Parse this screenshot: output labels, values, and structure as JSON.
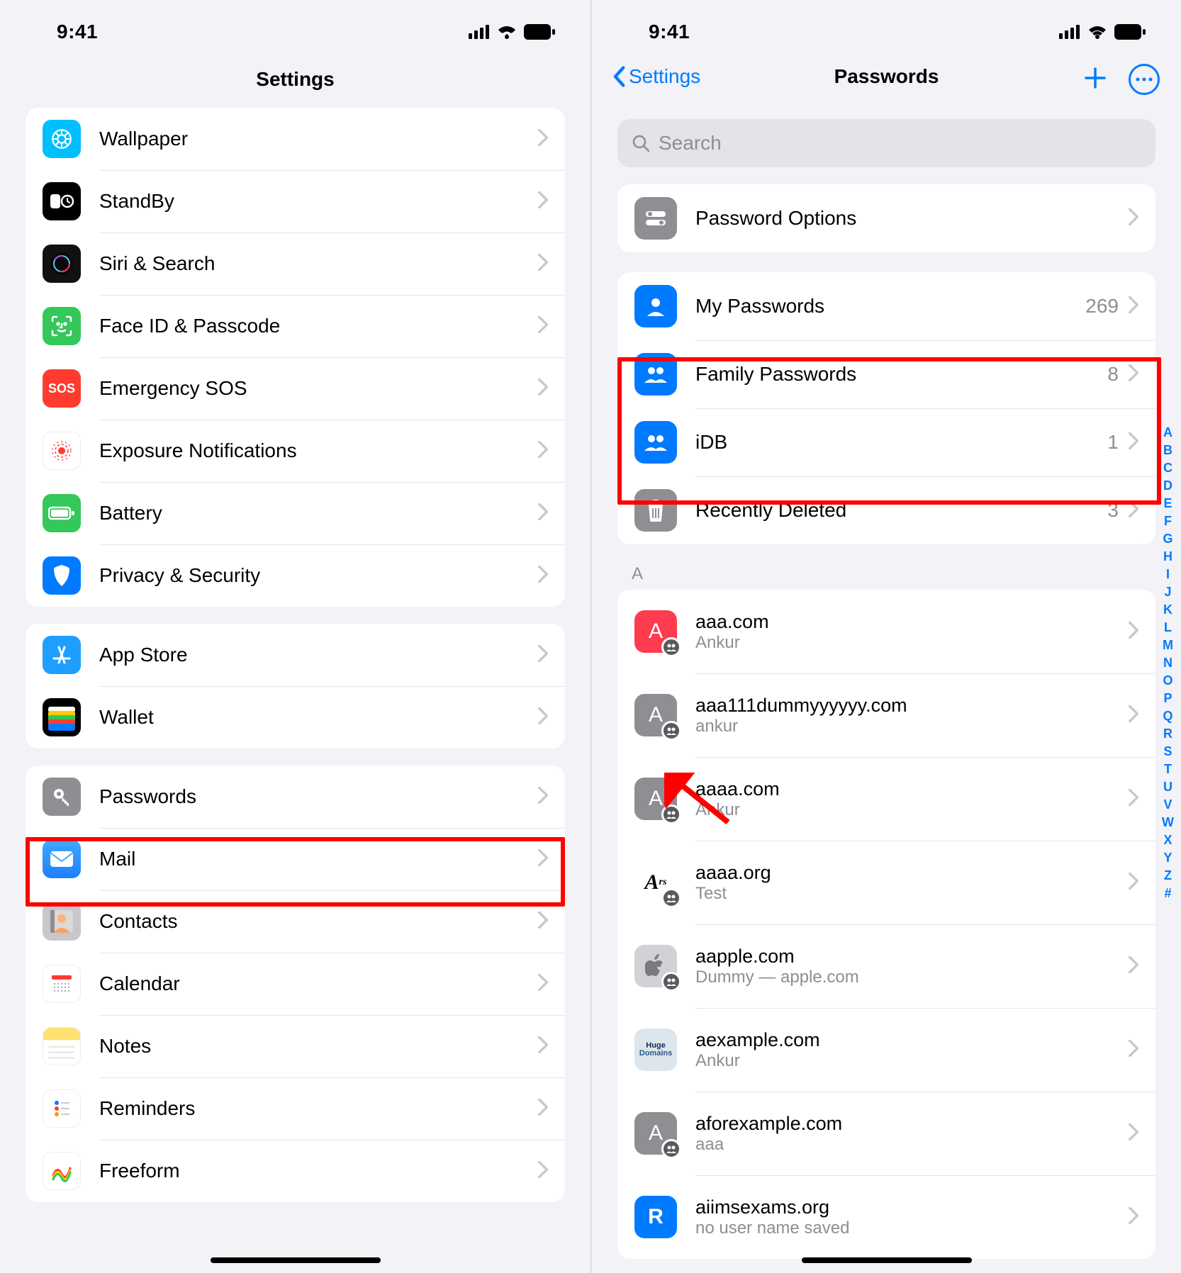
{
  "status": {
    "time": "9:41"
  },
  "left": {
    "title": "Settings",
    "group1": [
      {
        "label": "Wallpaper",
        "icon": "wallpaper",
        "bg": "#00BFFF"
      },
      {
        "label": "StandBy",
        "icon": "standby",
        "bg": "#000000"
      },
      {
        "label": "Siri & Search",
        "icon": "siri",
        "bg": "#222"
      },
      {
        "label": "Face ID & Passcode",
        "icon": "faceid",
        "bg": "#34C759"
      },
      {
        "label": "Emergency SOS",
        "icon": "sos",
        "bg": "#FF3B30",
        "text": "SOS"
      },
      {
        "label": "Exposure Notifications",
        "icon": "exposure",
        "bg": "#FFFFFF"
      },
      {
        "label": "Battery",
        "icon": "battery",
        "bg": "#34C759"
      },
      {
        "label": "Privacy & Security",
        "icon": "privacy",
        "bg": "#007AFF"
      }
    ],
    "group2": [
      {
        "label": "App Store",
        "icon": "appstore",
        "bg": "#1E9FFF"
      },
      {
        "label": "Wallet",
        "icon": "wallet",
        "bg": "#FFFFFF"
      }
    ],
    "group3": [
      {
        "label": "Passwords",
        "icon": "passwords",
        "bg": "#8E8E93"
      },
      {
        "label": "Mail",
        "icon": "mail",
        "bg": "#1E90FF"
      },
      {
        "label": "Contacts",
        "icon": "contacts",
        "bg": "#B8B8BE"
      },
      {
        "label": "Calendar",
        "icon": "calendar",
        "bg": "#FFFFFF"
      },
      {
        "label": "Notes",
        "icon": "notes",
        "bg": "#FFE070"
      },
      {
        "label": "Reminders",
        "icon": "reminders",
        "bg": "#FFFFFF"
      },
      {
        "label": "Freeform",
        "icon": "freeform",
        "bg": "#FFFFFF"
      }
    ]
  },
  "right": {
    "back": "Settings",
    "title": "Passwords",
    "searchPlaceholder": "Search",
    "options": {
      "label": "Password Options"
    },
    "groups": [
      {
        "label": "My Passwords",
        "count": "269",
        "icon": "person",
        "bg": "#007AFF"
      },
      {
        "label": "Family Passwords",
        "count": "8",
        "icon": "people",
        "bg": "#007AFF"
      },
      {
        "label": "iDB",
        "count": "1",
        "icon": "people",
        "bg": "#007AFF"
      },
      {
        "label": "Recently Deleted",
        "count": "3",
        "icon": "trash",
        "bg": "#8E8E93"
      }
    ],
    "sectionHeader": "A",
    "entries": [
      {
        "title": "aaa.com",
        "sub": "Ankur",
        "tileBg": "#FF3B4E",
        "letter": "A",
        "shared": true
      },
      {
        "title": "aaa111dummyyyyyy.com",
        "sub": "ankur",
        "tileBg": "#8E8E93",
        "letter": "A",
        "shared": true
      },
      {
        "title": "aaaa.com",
        "sub": "Ankur",
        "tileBg": "#8E8E93",
        "letter": "A",
        "shared": true
      },
      {
        "title": "aaaa.org",
        "sub": "Test",
        "tileBg": "#FFFFFF",
        "black": true,
        "letter": "A₂",
        "shared": true
      },
      {
        "title": "aapple.com",
        "sub": "Dummy — apple.com",
        "tileBg": "#C7C7CC",
        "apple": true,
        "shared": true
      },
      {
        "title": "aexample.com",
        "sub": "Ankur",
        "tileBg": "#DDE6EC",
        "huge": true,
        "shared": false
      },
      {
        "title": "aforexample.com",
        "sub": "aaa",
        "tileBg": "#8E8E93",
        "letter": "A",
        "shared": true
      },
      {
        "title": "aiimsexams.org",
        "sub": "no user name saved",
        "tileBg": "#007AFF",
        "letter": "R",
        "shared": false
      }
    ],
    "index": [
      "A",
      "B",
      "C",
      "D",
      "E",
      "F",
      "G",
      "H",
      "I",
      "J",
      "K",
      "L",
      "M",
      "N",
      "O",
      "P",
      "Q",
      "R",
      "S",
      "T",
      "U",
      "V",
      "W",
      "X",
      "Y",
      "Z",
      "#"
    ]
  }
}
